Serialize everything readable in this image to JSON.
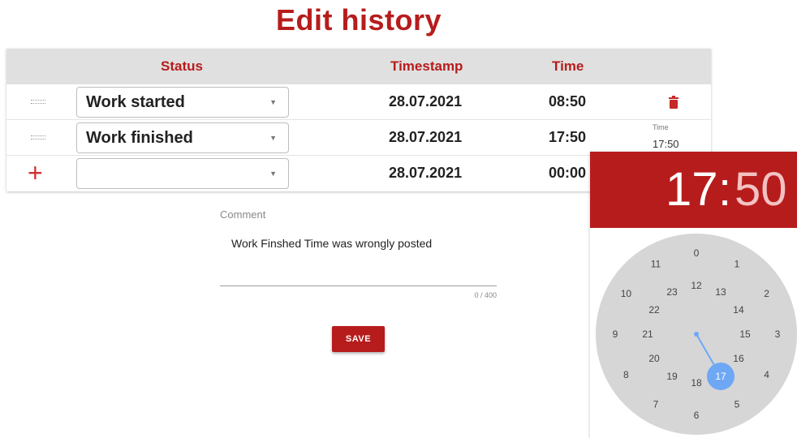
{
  "page": {
    "title": "Edit history"
  },
  "table": {
    "headers": {
      "status": "Status",
      "timestamp": "Timestamp",
      "time": "Time"
    },
    "rows": [
      {
        "status": "Work started",
        "timestamp": "28.07.2021",
        "time": "08:50"
      },
      {
        "status": "Work finished",
        "timestamp": "28.07.2021",
        "time": "17:50"
      },
      {
        "status": "",
        "timestamp": "28.07.2021",
        "time": "00:00"
      }
    ]
  },
  "comment": {
    "label": "Comment",
    "value": "Work Finshed Time was wrongly posted",
    "counter": "0 / 400"
  },
  "save_label": "SAVE",
  "time_picker": {
    "field_label": "Time",
    "field_value": "17:50",
    "hour": "17",
    "colon": ":",
    "minute": "50",
    "selected_hour": 17,
    "outer_hours": [
      "0",
      "1",
      "2",
      "3",
      "4",
      "5",
      "6",
      "7",
      "8",
      "9",
      "10",
      "11"
    ],
    "inner_hours": [
      "12",
      "13",
      "14",
      "15",
      "16",
      "17",
      "18",
      "19",
      "20",
      "21",
      "22",
      "23"
    ],
    "colors": {
      "header": "#b71c1c",
      "dial": "#d6d6d6",
      "hand": "#6ea8f5"
    }
  },
  "icons": {
    "drag": "drag-handle-icon",
    "add": "plus-icon",
    "delete": "trash-icon",
    "dropdown": "caret-down-icon"
  }
}
